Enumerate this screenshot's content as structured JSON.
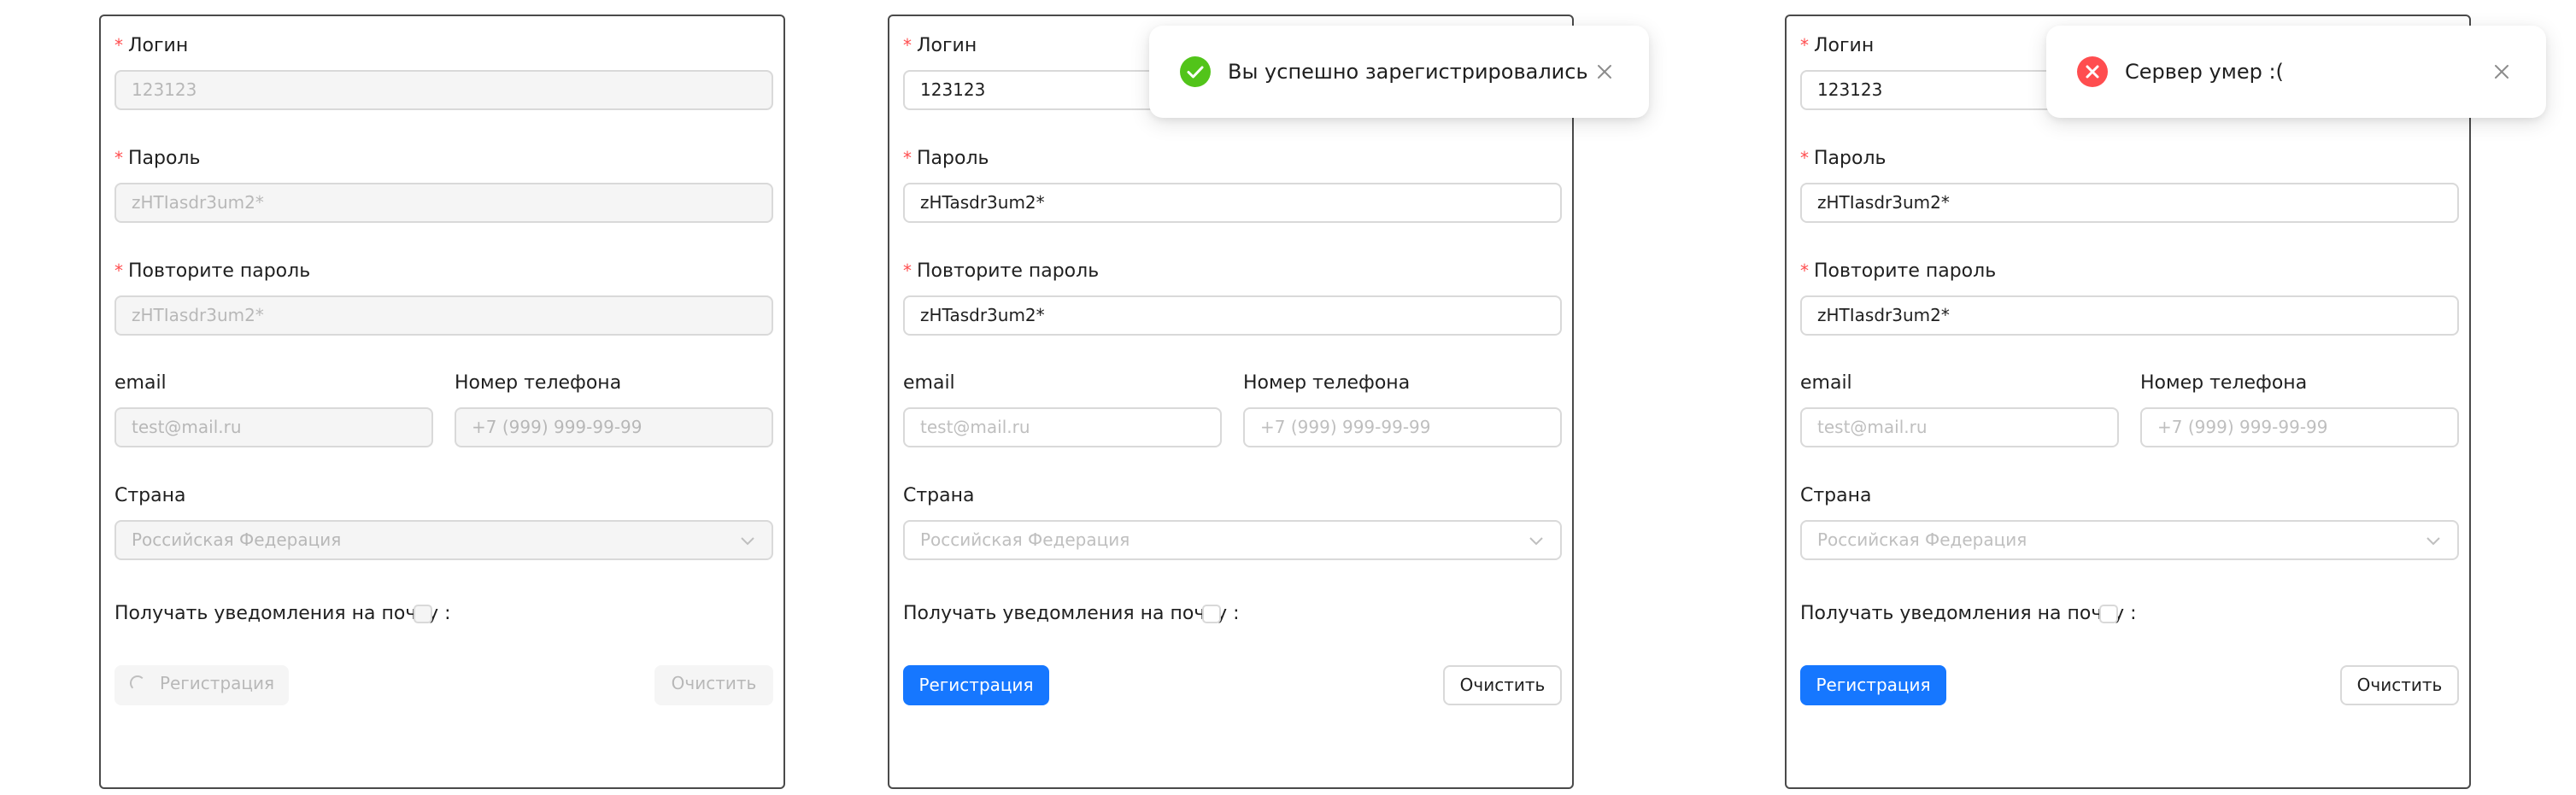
{
  "colors": {
    "primary": "#1677ff",
    "required": "#ff4d4f",
    "success": "#52c41a",
    "error": "#ff4d4f",
    "border": "#d9d9d9",
    "disabled_bg": "#f5f5f5"
  },
  "panels": [
    {
      "state": "loading-disabled",
      "login": {
        "label": "Логин",
        "value": "123123"
      },
      "password": {
        "label": "Пароль",
        "value": "zHTIasdr3um2*"
      },
      "password_repeat": {
        "label": "Повторите пароль",
        "value": "zHTIasdr3um2*"
      },
      "email": {
        "label": "email",
        "placeholder": "test@mail.ru"
      },
      "phone": {
        "label": "Номер телефона",
        "placeholder": "+7 (999) 999-99-99"
      },
      "country": {
        "label": "Страна",
        "placeholder": "Российская Федерация"
      },
      "notify": {
        "label": "Получать уведомления на почту :",
        "checked": false
      },
      "submit": {
        "label": "Регистрация",
        "loading": true
      },
      "clear": {
        "label": "Очистить"
      }
    },
    {
      "state": "success",
      "login": {
        "label": "Логин",
        "value": "123123"
      },
      "password": {
        "label": "Пароль",
        "value": "zHTasdr3um2*"
      },
      "password_repeat": {
        "label": "Повторите пароль",
        "value": "zHTasdr3um2*"
      },
      "email": {
        "label": "email",
        "placeholder": "test@mail.ru"
      },
      "phone": {
        "label": "Номер телефона",
        "placeholder": "+7 (999) 999-99-99"
      },
      "country": {
        "label": "Страна",
        "placeholder": "Российская Федерация"
      },
      "notify": {
        "label": "Получать уведомления на почту :",
        "checked": false
      },
      "submit": {
        "label": "Регистрация"
      },
      "clear": {
        "label": "Очистить"
      }
    },
    {
      "state": "error",
      "login": {
        "label": "Логин",
        "value": "123123"
      },
      "password": {
        "label": "Пароль",
        "value": "zHTIasdr3um2*"
      },
      "password_repeat": {
        "label": "Повторите пароль",
        "value": "zHTIasdr3um2*"
      },
      "email": {
        "label": "email",
        "placeholder": "test@mail.ru"
      },
      "phone": {
        "label": "Номер телефона",
        "placeholder": "+7 (999) 999-99-99"
      },
      "country": {
        "label": "Страна",
        "placeholder": "Российская Федерация"
      },
      "notify": {
        "label": "Получать уведомления на почту :",
        "checked": false
      },
      "submit": {
        "label": "Регистрация"
      },
      "clear": {
        "label": "Очистить"
      }
    }
  ],
  "notifications": {
    "success": {
      "text": "Вы успешно зарегистрировались",
      "icon": "check-circle-icon"
    },
    "error": {
      "text": "Сервер умер :(",
      "icon": "close-circle-icon"
    }
  }
}
